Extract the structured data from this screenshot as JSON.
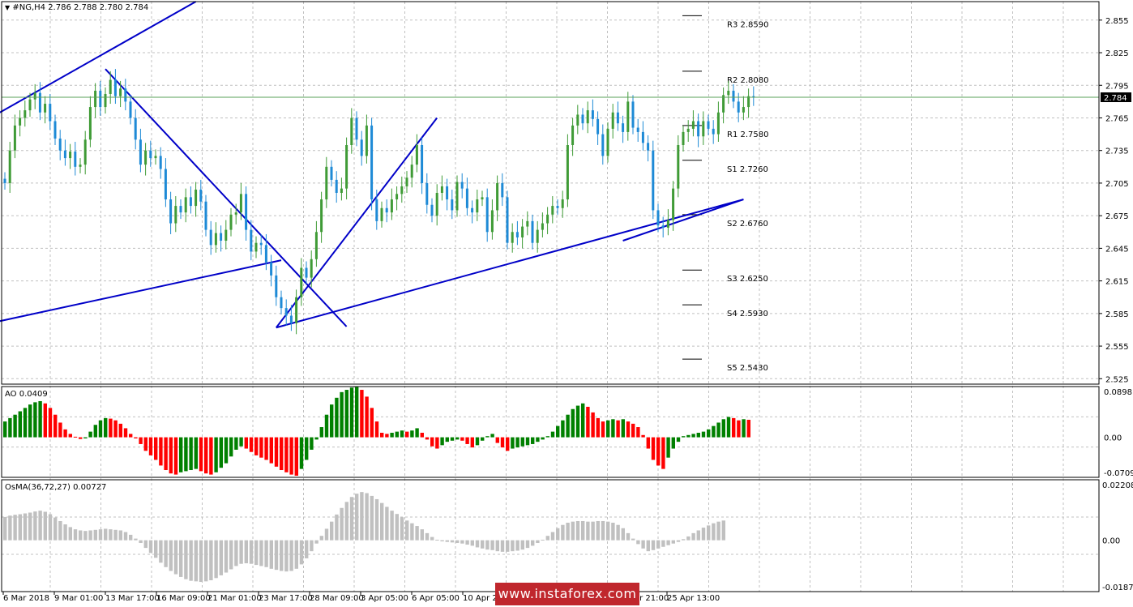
{
  "header": {
    "menu_arrow": "▼",
    "symbol_text": "#NG,H4  2.786 2.788 2.780 2.784"
  },
  "price_axis": {
    "ticks": [
      "2.855",
      "2.825",
      "2.795",
      "2.765",
      "2.735",
      "2.705",
      "2.675",
      "2.645",
      "2.615",
      "2.585",
      "2.555",
      "2.525"
    ],
    "current_price": "2.784"
  },
  "pivot_levels": [
    {
      "label": "R3 2.8590",
      "value": 2.859
    },
    {
      "label": "R2 2.8080",
      "value": 2.808
    },
    {
      "label": "R1 2.7580",
      "value": 2.758
    },
    {
      "label": "S1 2.7260",
      "value": 2.726
    },
    {
      "label": "S2 2.6760",
      "value": 2.676
    },
    {
      "label": "S3 2.6250",
      "value": 2.625
    },
    {
      "label": "S4 2.5930",
      "value": 2.593
    },
    {
      "label": "S5 2.5430",
      "value": 2.543
    }
  ],
  "ao_panel": {
    "title": "AO 0.0409",
    "axis": [
      "0.0898",
      "0.00",
      "-0.0709"
    ]
  },
  "osma_panel": {
    "title": "OsMA(36,72,27) 0.00727",
    "axis": [
      "0.02208",
      "0.00",
      "-0.01874"
    ]
  },
  "time_axis": [
    "6 Mar 2018",
    "9 Mar 01:00",
    "13 Mar 17:00",
    "16 Mar 09:00",
    "21 Mar 01:00",
    "23 Mar 17:00",
    "28 Mar 09:00",
    "3 Apr 05:00",
    "6 Apr 05:00",
    "10 Apr 21:00",
    "",
    "",
    "18 Apr 21:00",
    "25 Apr 13:00"
  ],
  "watermark": "www.instaforex.com",
  "colors": {
    "bull": "#3f9b36",
    "bear": "#1e8ad6",
    "trend": "#0000c8",
    "ao_up": "#008000",
    "ao_down": "#ff0000",
    "osma": "#c0c0c0",
    "price_line": "#58a058",
    "grid": "#c0c0c0"
  },
  "chart_data": {
    "type": "candlestick",
    "symbol": "#NG",
    "timeframe": "H4",
    "ohlc_last": {
      "open": 2.786,
      "high": 2.788,
      "low": 2.78,
      "close": 2.784
    },
    "y_range": [
      2.52,
      2.872
    ],
    "closes": [
      2.705,
      2.735,
      2.758,
      2.765,
      2.772,
      2.782,
      2.788,
      2.77,
      2.778,
      2.762,
      2.746,
      2.735,
      2.728,
      2.734,
      2.72,
      2.722,
      2.745,
      2.775,
      2.79,
      2.775,
      2.787,
      2.8,
      2.785,
      2.792,
      2.78,
      2.765,
      2.745,
      2.722,
      2.735,
      2.728,
      2.73,
      2.718,
      2.69,
      2.668,
      2.684,
      2.678,
      2.692,
      2.684,
      2.699,
      2.688,
      2.662,
      2.648,
      2.659,
      2.652,
      2.662,
      2.676,
      2.678,
      2.695,
      2.662,
      2.642,
      2.65,
      2.648,
      2.632,
      2.62,
      2.6,
      2.59,
      2.583,
      2.576,
      2.6,
      2.627,
      2.618,
      2.635,
      2.66,
      2.69,
      2.72,
      2.708,
      2.696,
      2.7,
      2.74,
      2.765,
      2.745,
      2.73,
      2.758,
      2.69,
      2.67,
      2.682,
      2.678,
      2.69,
      2.695,
      2.702,
      2.71,
      2.722,
      2.74,
      2.705,
      2.685,
      2.675,
      2.696,
      2.702,
      2.69,
      2.68,
      2.706,
      2.7,
      2.682,
      2.678,
      2.69,
      2.692,
      2.66,
      2.68,
      2.705,
      2.692,
      2.65,
      2.66,
      2.655,
      2.665,
      2.67,
      2.65,
      2.662,
      2.668,
      2.676,
      2.684,
      2.682,
      2.69,
      2.74,
      2.758,
      2.768,
      2.76,
      2.772,
      2.764,
      2.75,
      2.73,
      2.755,
      2.77,
      2.76,
      2.752,
      2.78,
      2.756,
      2.752,
      2.742,
      2.735,
      2.68,
      2.666,
      2.664,
      2.671,
      2.7,
      2.74,
      2.752,
      2.755,
      2.762,
      2.748,
      2.762,
      2.755,
      2.75,
      2.77,
      2.786,
      2.79,
      2.78,
      2.77,
      2.775,
      2.785,
      2.784
    ],
    "ao": [
      0.028,
      0.034,
      0.04,
      0.046,
      0.052,
      0.058,
      0.062,
      0.064,
      0.06,
      0.052,
      0.04,
      0.026,
      0.014,
      0.006,
      0.001,
      -0.003,
      -0.002,
      0.01,
      0.022,
      0.03,
      0.034,
      0.033,
      0.03,
      0.024,
      0.016,
      0.006,
      -0.002,
      -0.012,
      -0.024,
      -0.032,
      -0.04,
      -0.05,
      -0.058,
      -0.064,
      -0.066,
      -0.062,
      -0.06,
      -0.058,
      -0.056,
      -0.06,
      -0.064,
      -0.066,
      -0.062,
      -0.054,
      -0.046,
      -0.034,
      -0.022,
      -0.016,
      -0.02,
      -0.026,
      -0.032,
      -0.036,
      -0.04,
      -0.046,
      -0.052,
      -0.058,
      -0.062,
      -0.066,
      -0.068,
      -0.056,
      -0.04,
      -0.022,
      -0.004,
      0.018,
      0.04,
      0.058,
      0.07,
      0.08,
      0.084,
      0.088,
      0.089,
      0.084,
      0.072,
      0.052,
      0.028,
      0.008,
      0.006,
      0.008,
      0.01,
      0.012,
      0.01,
      0.012,
      0.016,
      0.008,
      -0.004,
      -0.016,
      -0.02,
      -0.014,
      -0.008,
      -0.006,
      -0.004,
      -0.006,
      -0.012,
      -0.018,
      -0.014,
      -0.006,
      0.002,
      0.006,
      -0.01,
      -0.018,
      -0.024,
      -0.02,
      -0.018,
      -0.016,
      -0.014,
      -0.012,
      -0.008,
      -0.004,
      0.002,
      0.01,
      0.02,
      0.03,
      0.04,
      0.05,
      0.056,
      0.06,
      0.054,
      0.044,
      0.034,
      0.028,
      0.03,
      0.032,
      0.03,
      0.032,
      0.028,
      0.024,
      0.018,
      0.004,
      -0.02,
      -0.04,
      -0.05,
      -0.056,
      -0.036,
      -0.02,
      -0.008,
      0.002,
      0.004,
      0.006,
      0.008,
      0.01,
      0.014,
      0.02,
      0.026,
      0.032,
      0.036,
      0.034,
      0.03,
      0.032,
      0.031
    ],
    "osma": [
      0.0085,
      0.009,
      0.0093,
      0.0095,
      0.0098,
      0.0101,
      0.0105,
      0.0108,
      0.0104,
      0.0095,
      0.0083,
      0.007,
      0.0058,
      0.0048,
      0.004,
      0.0036,
      0.0034,
      0.0036,
      0.0038,
      0.004,
      0.0042,
      0.004,
      0.0038,
      0.0036,
      0.003,
      0.002,
      0.0006,
      -0.001,
      -0.0028,
      -0.0046,
      -0.0064,
      -0.0082,
      -0.0098,
      -0.0112,
      -0.0124,
      -0.0134,
      -0.0142,
      -0.0148,
      -0.015,
      -0.0152,
      -0.015,
      -0.0146,
      -0.0138,
      -0.0128,
      -0.0118,
      -0.0106,
      -0.0094,
      -0.0086,
      -0.0084,
      -0.0086,
      -0.009,
      -0.0094,
      -0.0098,
      -0.0104,
      -0.0108,
      -0.0112,
      -0.0114,
      -0.0112,
      -0.0104,
      -0.0088,
      -0.0066,
      -0.004,
      -0.0012,
      0.0016,
      0.0042,
      0.0068,
      0.0094,
      0.0118,
      0.014,
      0.0158,
      0.017,
      0.0176,
      0.0172,
      0.0162,
      0.015,
      0.0136,
      0.0122,
      0.0108,
      0.0096,
      0.0084,
      0.0072,
      0.0062,
      0.0052,
      0.004,
      0.0026,
      0.0012,
      0.0002,
      -0.0004,
      -0.0006,
      -0.0008,
      -0.001,
      -0.0012,
      -0.0016,
      -0.002,
      -0.0026,
      -0.003,
      -0.0034,
      -0.0036,
      -0.004,
      -0.0042,
      -0.0042,
      -0.004,
      -0.0038,
      -0.0034,
      -0.0028,
      -0.002,
      -0.001,
      0.0002,
      0.0016,
      0.003,
      0.0044,
      0.0056,
      0.0064,
      0.0068,
      0.007,
      0.007,
      0.0068,
      0.0068,
      0.007,
      0.007,
      0.0068,
      0.0064,
      0.0056,
      0.0044,
      0.0026,
      0.0006,
      -0.0014,
      -0.003,
      -0.004,
      -0.0036,
      -0.003,
      -0.0024,
      -0.0018,
      -0.0012,
      -0.0006,
      0.0004,
      0.0014,
      0.0026,
      0.0036,
      0.0046,
      0.0054,
      0.0062,
      0.0068,
      0.0072
    ]
  }
}
